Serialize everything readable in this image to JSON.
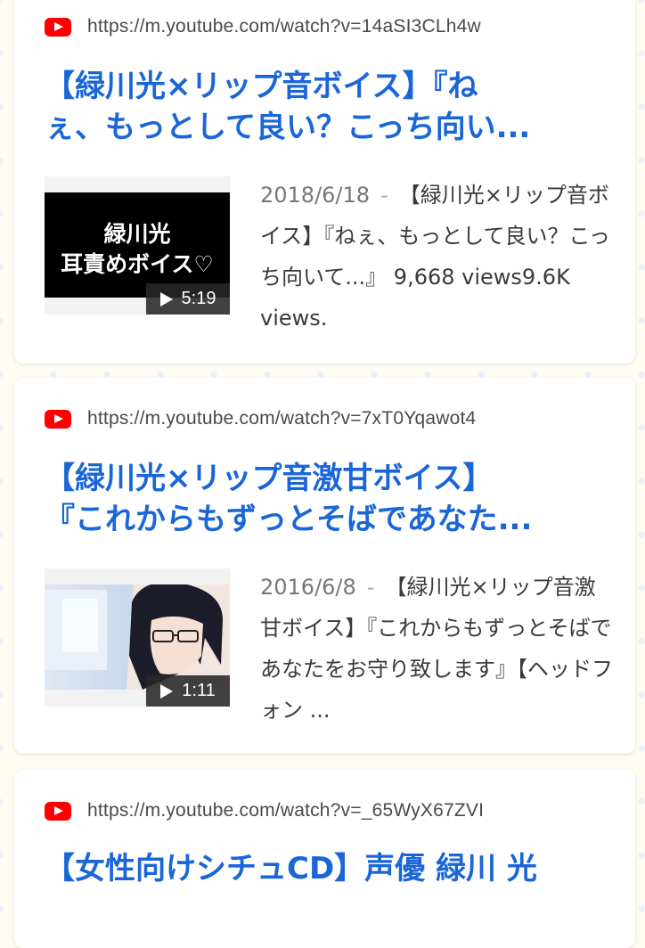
{
  "results": [
    {
      "url": "https://m.youtube.com/watch?v=14aSI3CLh4w",
      "title_line1": "【緑川光×リップ音ボイス】『ね",
      "title_line2": "ぇ、もっとして良い？こっち向い...",
      "thumb_text_line1": "緑川光",
      "thumb_text_line2": "耳責めボイス♡",
      "duration": "5:19",
      "date": "2018/6/18",
      "snippet": "【緑川光×リップ音ボイス】『ねぇ、もっとして良い？こっち向いて...』 9,668 views9.6K views."
    },
    {
      "url": "https://m.youtube.com/watch?v=7xT0Yqawot4",
      "title_line1": "【緑川光×リップ音激甘ボイス】",
      "title_line2": "『これからもずっとそばであなた...",
      "duration": "1:11",
      "date": "2016/6/8",
      "snippet": "【緑川光×リップ音激甘ボイス】『これからもずっとそばであなたをお守り致します』【ヘッドフォン ..."
    },
    {
      "url": "https://m.youtube.com/watch?v=_65WyX67ZVI",
      "title_line1": "【女性向けシチュCD】声優 緑川 光"
    }
  ],
  "separator": "-",
  "colors": {
    "title": "#1a66d8",
    "youtube": "#ff0000"
  },
  "icons": {
    "source": "youtube-icon",
    "play": "play-icon"
  }
}
